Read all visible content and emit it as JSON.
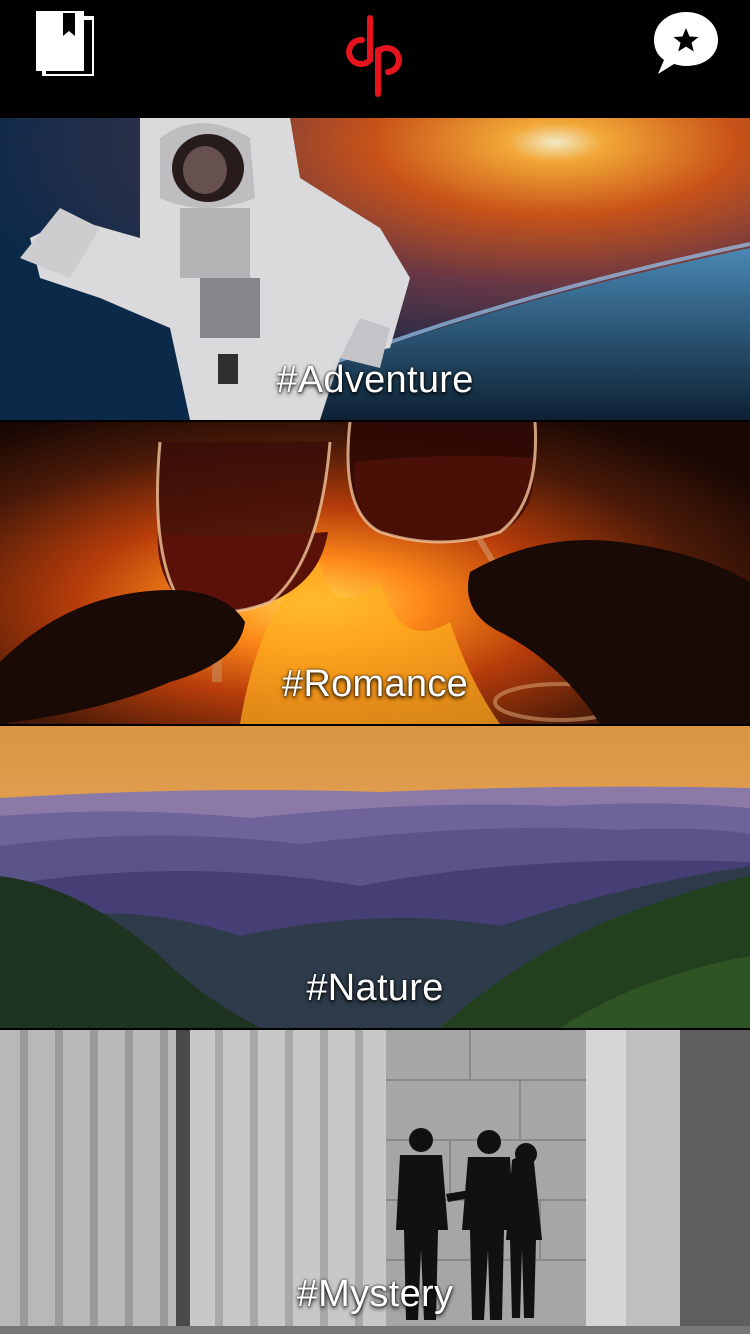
{
  "header": {
    "library_icon": "book-library-icon",
    "logo_icon": "app-logo-icon",
    "favorites_icon": "speech-bubble-star-icon",
    "accent_color": "#e8141d"
  },
  "genres": [
    {
      "label": "#Adventure",
      "image": "astronaut-in-space"
    },
    {
      "label": "#Romance",
      "image": "wine-glasses-fireplace"
    },
    {
      "label": "#Nature",
      "image": "mountain-range-sunset"
    },
    {
      "label": "#Mystery",
      "image": "silhouettes-among-columns"
    }
  ]
}
